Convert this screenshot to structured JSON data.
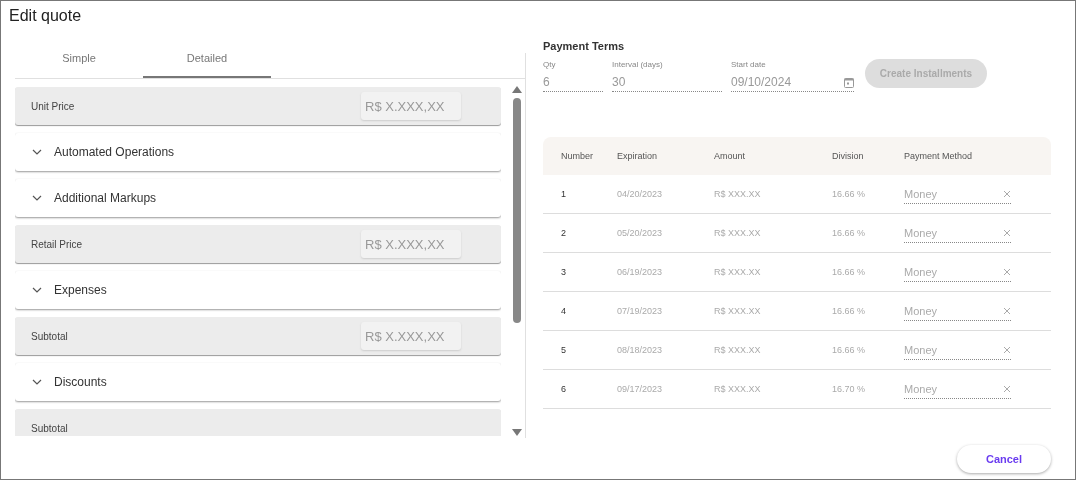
{
  "dialog": {
    "title": "Edit quote"
  },
  "tabs": [
    {
      "label": "Simple",
      "selected": false
    },
    {
      "label": "Detailed",
      "selected": true
    }
  ],
  "pricing_items": [
    {
      "kind": "price",
      "label": "Unit Price",
      "placeholder": "R$ X.XXX,XX"
    },
    {
      "kind": "section",
      "label": "Automated Operations",
      "expanded": false
    },
    {
      "kind": "section",
      "label": "Additional Markups",
      "expanded": false
    },
    {
      "kind": "price",
      "label": "Retail Price",
      "placeholder": "R$ X.XXX,XX"
    },
    {
      "kind": "section",
      "label": "Expenses",
      "expanded": false
    },
    {
      "kind": "price",
      "label": "Subtotal",
      "placeholder": "R$ X.XXX,XX"
    },
    {
      "kind": "section",
      "label": "Discounts",
      "expanded": false
    },
    {
      "kind": "price",
      "label": "Subtotal"
    }
  ],
  "payment_terms": {
    "title": "Payment Terms",
    "fields": [
      {
        "kind": "text",
        "label": "Qty",
        "value": "6"
      },
      {
        "kind": "text",
        "label": "Interval (days)",
        "value": "30"
      },
      {
        "kind": "date",
        "label": "Start date",
        "value": "09/10/2024"
      }
    ],
    "create_button": {
      "label": "Create Installments",
      "disabled": true
    }
  },
  "table": {
    "columns": [
      "Number",
      "Expiration",
      "Amount",
      "Division",
      "Payment Method"
    ],
    "rows": [
      [
        "1",
        "04/20/2023",
        "R$ XXX.XX",
        "16.66 %",
        "Money"
      ],
      [
        "2",
        "05/20/2023",
        "R$ XXX.XX",
        "16.66 %",
        "Money"
      ],
      [
        "3",
        "06/19/2023",
        "R$ XXX.XX",
        "16.66 %",
        "Money"
      ],
      [
        "4",
        "07/19/2023",
        "R$ XXX.XX",
        "16.66 %",
        "Money"
      ],
      [
        "5",
        "08/18/2023",
        "R$ XXX.XX",
        "16.66 %",
        "Money"
      ],
      [
        "6",
        "09/17/2023",
        "R$ XXX.XX",
        "16.70 %",
        "Money"
      ]
    ]
  },
  "buttons": [
    {
      "label": "Cancel"
    }
  ]
}
